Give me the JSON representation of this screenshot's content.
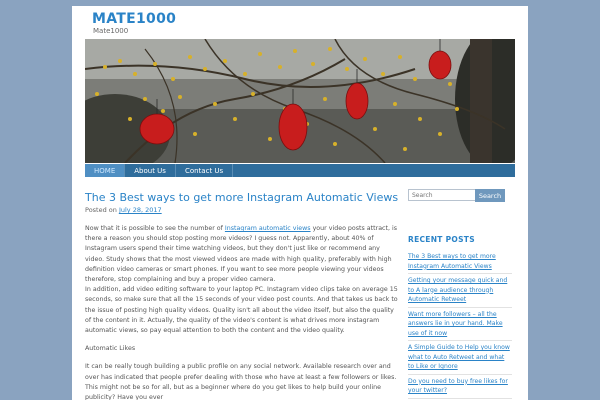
{
  "site": {
    "title": "MATE1000",
    "description": "Mate1000"
  },
  "nav": {
    "items": [
      {
        "label": "HOME"
      },
      {
        "label": "About Us"
      },
      {
        "label": "Contact Us"
      }
    ]
  },
  "post": {
    "title": "The 3 Best ways to get more Instagram Automatic Views",
    "meta_prefix": "Posted on",
    "date": "July 28, 2017",
    "p1_before_link": "Now that it is possible to see the number of ",
    "p1_link": "Instagram automatic views",
    "p1_after_link": " your video posts attract, is there a reason you should stop posting more videos? I guess not. Apparently, about 40% of Instagram users spend their time watching videos, but they don't just like or recommend any video. Study shows that the most viewed videos are made with high quality, preferably with high definition video cameras or smart phones. If you want to see more people viewing your videos therefore, stop complaining and buy a proper video camera.",
    "p2": "In addition, add video editing software to your laptop PC. Instagram video clips take on average 15 seconds, so make sure that all the 15 seconds of your video post counts. And that takes us back to the issue of posting high quality videos. Quality isn't all about the video itself, but also the quality of the content in it. Actually, the quality of the video's content is what drives more instagram automatic views, so pay equal attention to both the content and the video quality.",
    "p3": "Automatic Likes",
    "p4": "It can be really tough building a public profile on any social network.  Available research over and over has indicated that people prefer dealing with those who have at least a few followers or likes.  This might not be so for all, but as a beginner where do you get likes to help build your online publicity?  Have you ever"
  },
  "sidebar": {
    "search_placeholder": "Search",
    "search_button": "Search",
    "recent_heading": "RECENT POSTS",
    "recent_posts": [
      {
        "label": "The 3 Best ways to get more Instagram Automatic Views"
      },
      {
        "label": "Getting your message quick and to A large audience through Automatic Retweet"
      },
      {
        "label": "Want more followers – all the answers lie in your hand. Make use of it now"
      },
      {
        "label": "A Simple Guide to Help you know what to Auto Retweet and what to Like or Ignore"
      },
      {
        "label": "Do you need to buy free likes for your twitter?"
      }
    ]
  },
  "colors": {
    "background": "#8aa3c0",
    "accent": "#2a83c7",
    "nav": "#2f6d9c"
  }
}
